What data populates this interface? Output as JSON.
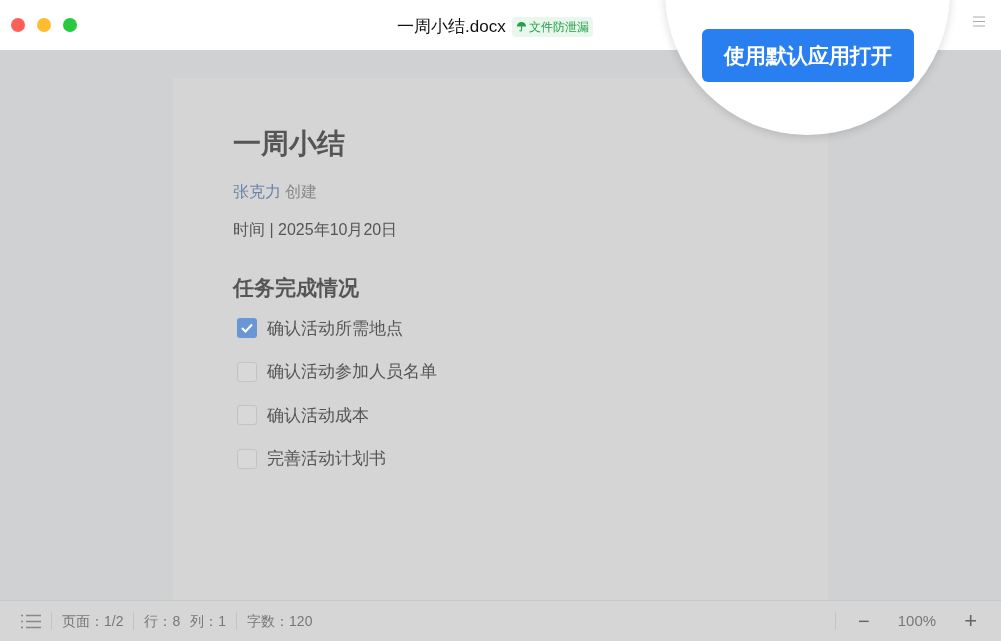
{
  "window": {
    "title": "一周小结.docx",
    "badge": "文件防泄漏"
  },
  "callout": {
    "button": "使用默认应用打开"
  },
  "document": {
    "title": "一周小结",
    "author": "张克力",
    "author_suffix": "创建",
    "date_line": "时间 | 2025年10月20日",
    "section": "任务完成情况",
    "tasks": [
      {
        "label": "确认活动所需地点",
        "checked": true
      },
      {
        "label": "确认活动参加人员名单",
        "checked": false
      },
      {
        "label": "确认活动成本",
        "checked": false
      },
      {
        "label": "完善活动计划书",
        "checked": false
      }
    ]
  },
  "status_bar": {
    "page": "页面：1/2",
    "row": "行：8",
    "column": "列：1",
    "words": "字数：120",
    "zoom": "100%",
    "zoom_out": "−",
    "zoom_in": "+"
  }
}
